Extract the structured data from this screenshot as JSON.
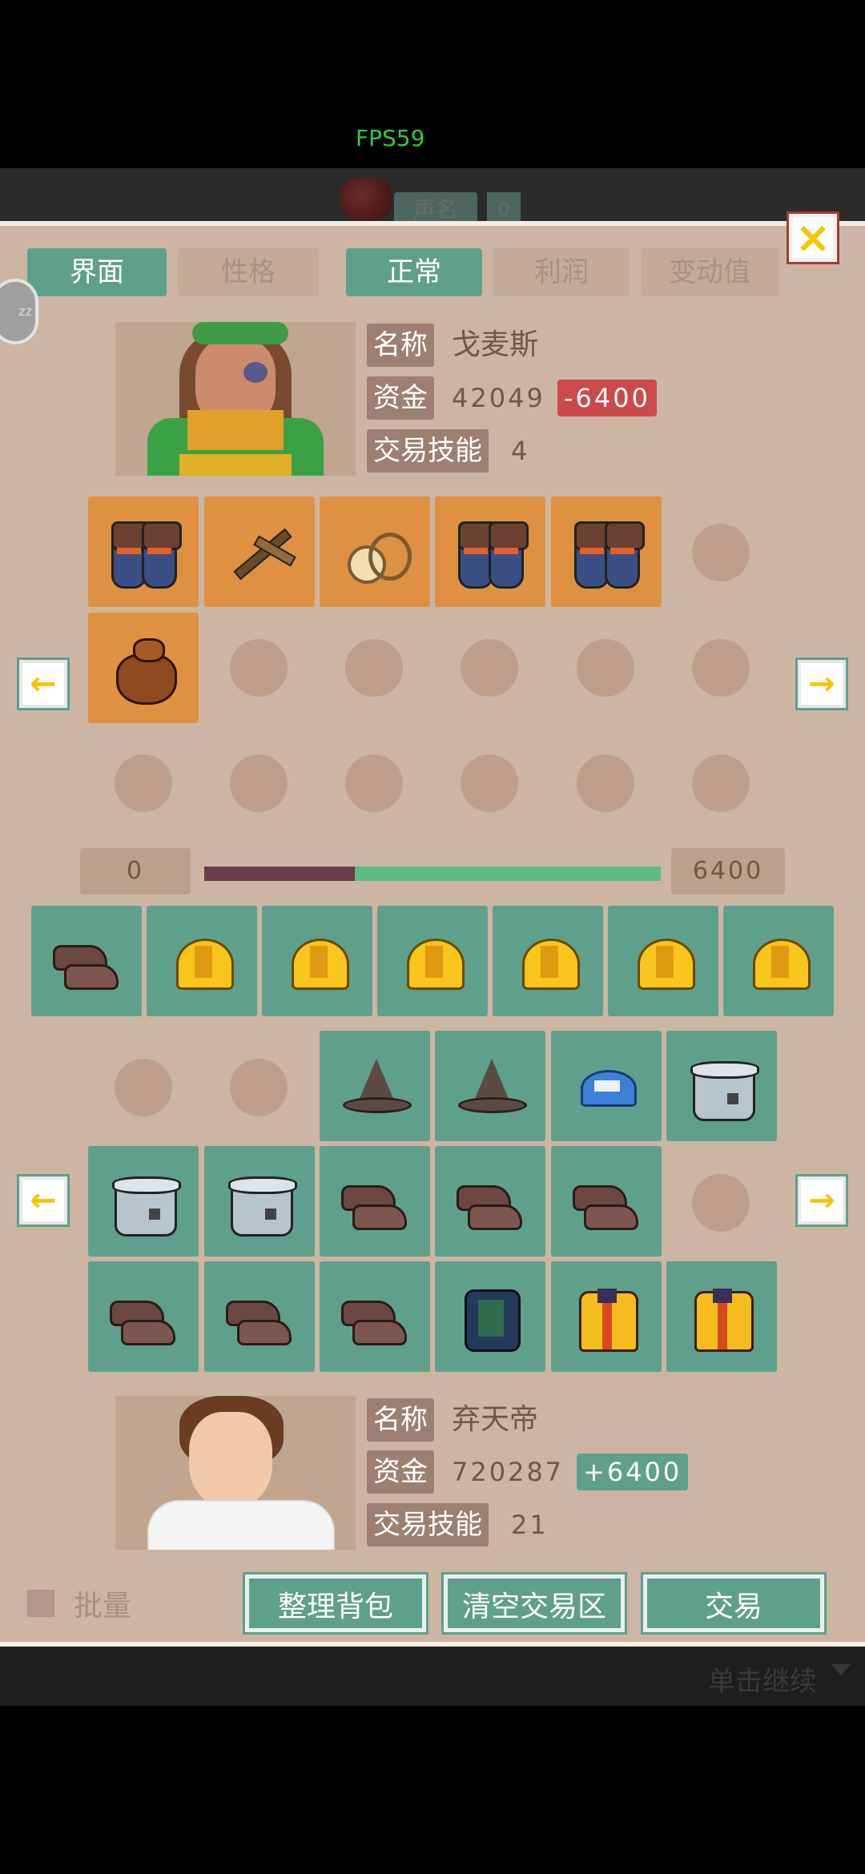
{
  "hud": {
    "fps": "FPS59"
  },
  "topbar": {
    "label": "声名",
    "count": "0"
  },
  "tabs_left": [
    {
      "label": "界面",
      "active": true
    },
    {
      "label": "性格",
      "active": false
    }
  ],
  "tabs_right": [
    {
      "label": "正常",
      "active": true
    },
    {
      "label": "利润",
      "active": false
    },
    {
      "label": "变动值",
      "active": false
    }
  ],
  "sidebubble": "zz",
  "close_icon": "×",
  "merchant": {
    "name_tag": "名称",
    "name": "戈麦斯",
    "funds_tag": "资金",
    "funds": "42049",
    "funds_delta": "-6400",
    "skill_tag": "交易技能",
    "skill": "4"
  },
  "merchant_items": [
    "gloves-icon",
    "pickaxe-icon",
    "rope-icon",
    "gloves-icon",
    "gloves-icon",
    "empty",
    "sack-icon",
    "empty",
    "empty",
    "empty",
    "empty",
    "empty",
    "empty",
    "empty",
    "empty",
    "empty",
    "empty",
    "empty"
  ],
  "trade": {
    "left_value": "0",
    "right_value": "6400",
    "progress": 0.33
  },
  "trade_row": [
    "shoes-icon",
    "helmet-icon",
    "helmet-icon",
    "helmet-icon",
    "helmet-icon",
    "helmet-icon",
    "helmet-icon"
  ],
  "player_items": [
    "empty",
    "empty",
    "wizard-hat-icon",
    "wizard-hat-icon",
    "cap-icon",
    "pot-icon",
    "pot-icon",
    "pot-icon",
    "shoes-icon",
    "shoes-icon",
    "shoes-icon",
    "empty",
    "shoes-icon",
    "shoes-icon",
    "shoes-icon",
    "armor-icon",
    "jacket-icon",
    "jacket-icon"
  ],
  "player": {
    "name_tag": "名称",
    "name": "弃天帝",
    "funds_tag": "资金",
    "funds": "720287",
    "funds_delta": "+6400",
    "skill_tag": "交易技能",
    "skill": "21"
  },
  "bottom": {
    "batch_label": "批量",
    "sort_label": "整理背包",
    "clear_label": "清空交易区",
    "trade_label": "交易"
  },
  "footer": {
    "continue": "单击继续"
  },
  "arrows": {
    "left": "←",
    "right": "→"
  },
  "colors": {
    "accent_green": "#5fa08c",
    "orange_slot": "#de9140",
    "panel": "#cdb5a3",
    "negative": "#cc4a4a"
  }
}
